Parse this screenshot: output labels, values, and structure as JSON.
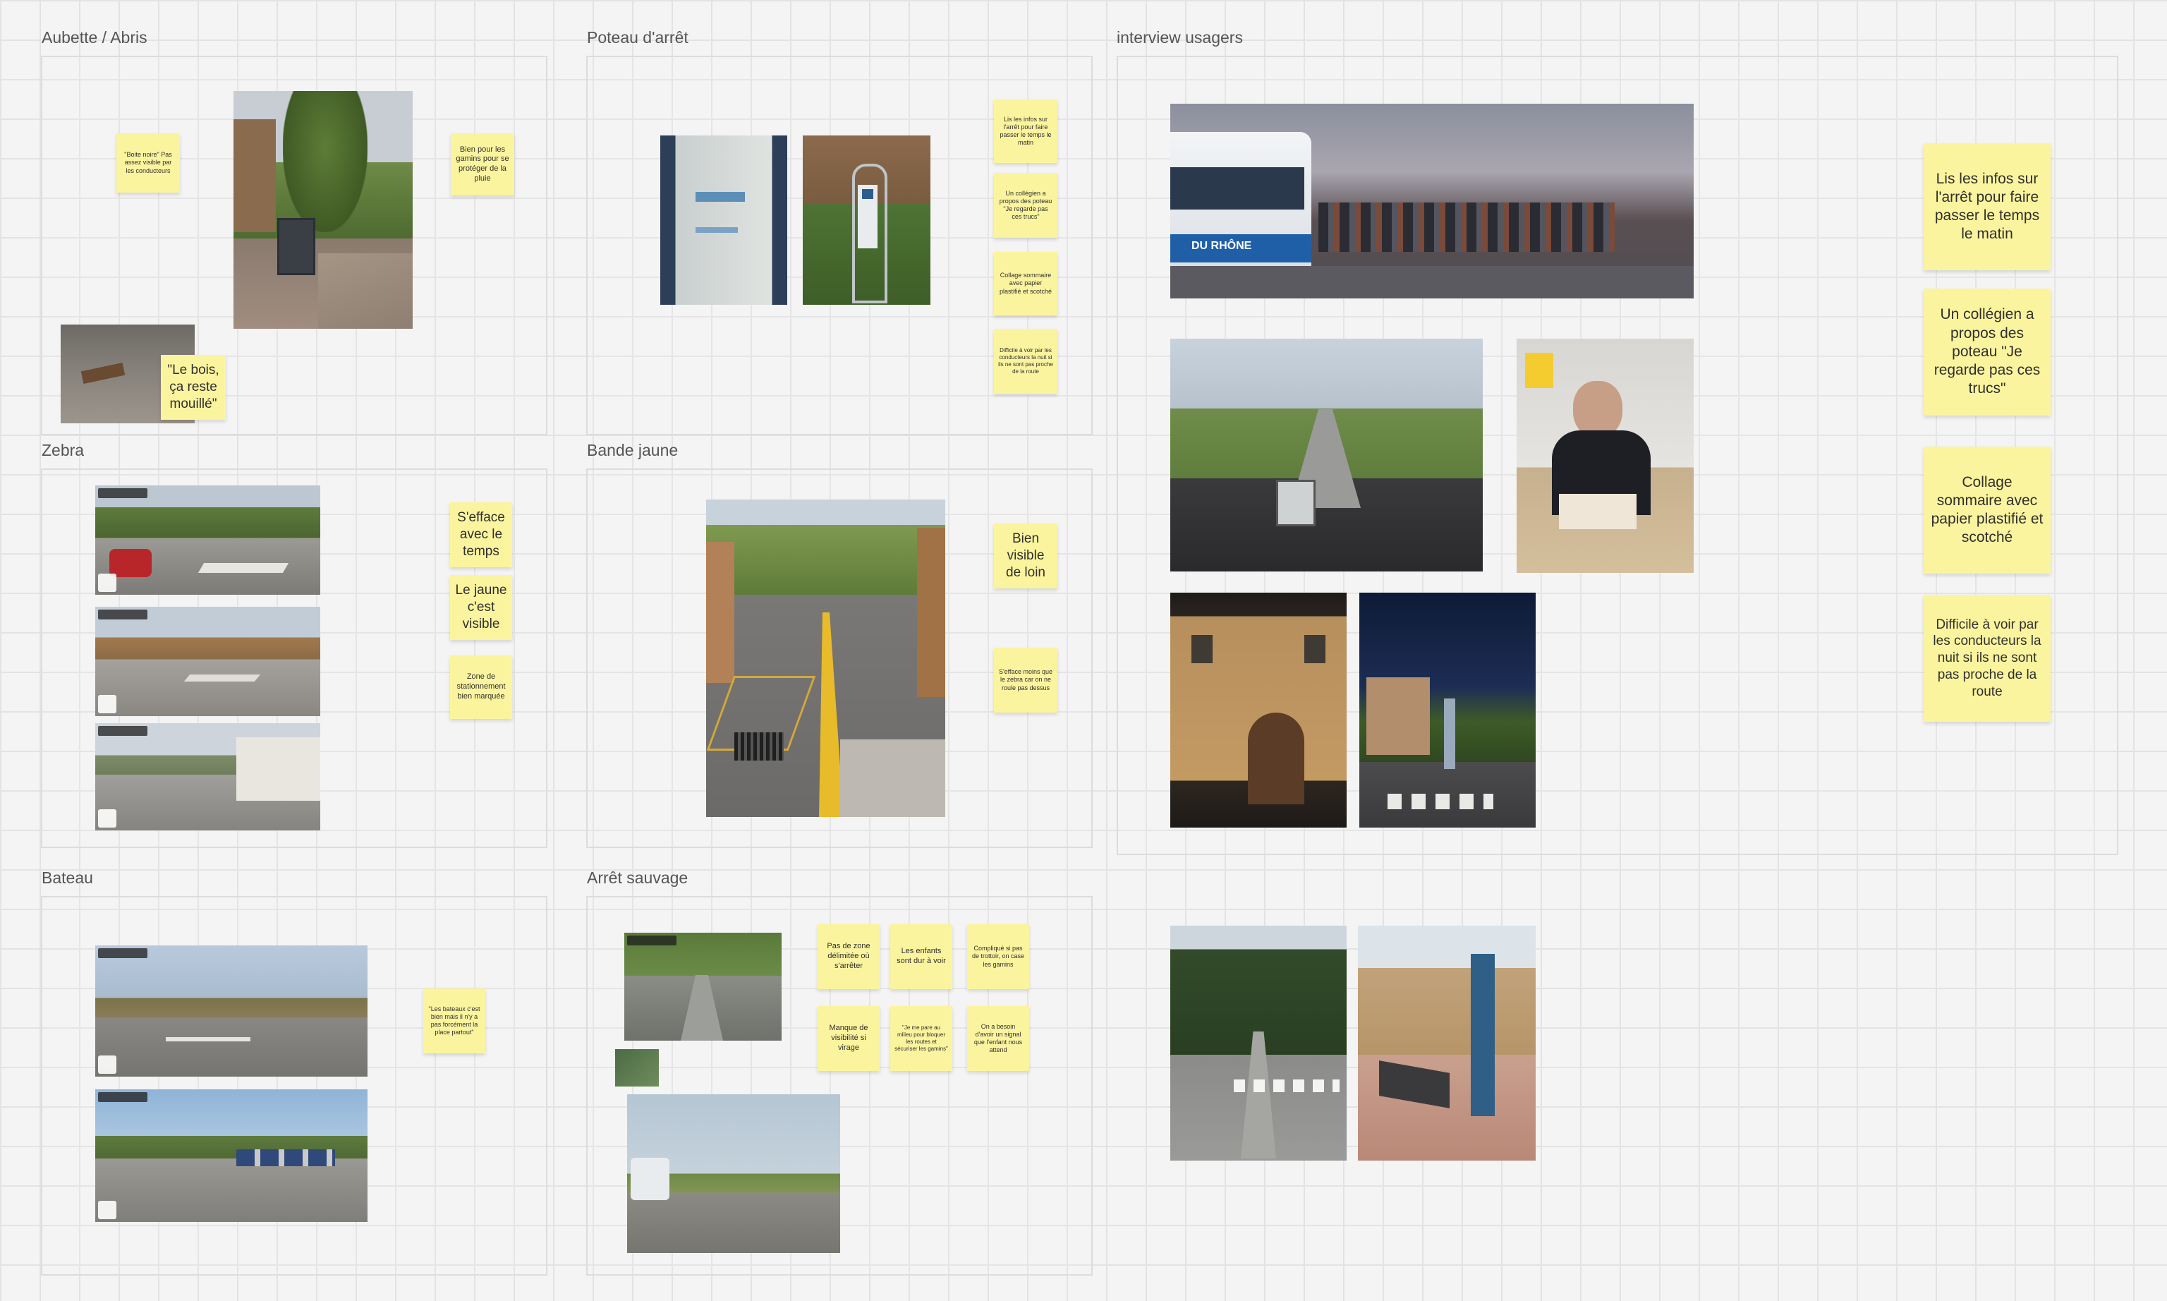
{
  "frames": {
    "aubette": "Aubette / Abris",
    "poteau": "Poteau d'arrêt",
    "interview": "interview usagers",
    "zebra": "Zebra",
    "bande": "Bande jaune",
    "bateau": "Bateau",
    "sauvage": "Arrêt sauvage"
  },
  "stickies": {
    "aubette_1": "\"Boite noire\" Pas assez visible par les conducteurs",
    "aubette_2": "Bien pour les gamins pour se protéger de la pluie",
    "aubette_3": "\"Le bois, ça reste mouillé\"",
    "poteau_1": "Lis les infos sur l'arrêt pour faire passer le temps le matin",
    "poteau_2": "Un collégien a propos des poteau \"Je regarde pas ces trucs\"",
    "poteau_3": "Collage sommaire avec papier plastifié et scotché",
    "poteau_4": "Difficile à voir par les conducteurs la nuit si ils ne sont pas proche de la route",
    "zebra_1": "S'efface avec le temps",
    "zebra_2": "Le jaune c'est visible",
    "zebra_3": "Zone de stationnement bien marquée",
    "bande_1": "Bien visible de loin",
    "bande_2": "S'efface moins que le zebra car on ne roule pas dessus",
    "bateau_1": "\"Les bateaux c'est bien mais il n'y a pas forcément la place partout\"",
    "sauvage_1": "Pas de zone délimitée où s'arrêter",
    "sauvage_2": "Les enfants sont dur à voir",
    "sauvage_3": "Compliqué si pas de trottoir, on case les gamins",
    "sauvage_4": "Manque de visibilité si virage",
    "sauvage_5": "\"Je me pare au milieu pour bloquer les routes et sécuriser les gamins\"",
    "sauvage_6": "On a besoin d'avoir un signal que l'enfant nous attend",
    "interview_1": "Lis les infos sur l'arrêt pour faire passer le temps le matin",
    "interview_2": "Un collégien a propos des poteau \"Je regarde pas ces trucs\"",
    "interview_3": "Collage sommaire avec papier plastifié et scotché",
    "interview_4": "Difficile à voir par les conducteurs la nuit si ils ne sont pas proche de la route"
  },
  "bus_label": "DU RHÔNE",
  "colors": {
    "sticky": "#fbf49e",
    "board_bg": "#f4f4f4",
    "grid": "#e3e3e3",
    "frame_border": "#dcdcdc"
  }
}
